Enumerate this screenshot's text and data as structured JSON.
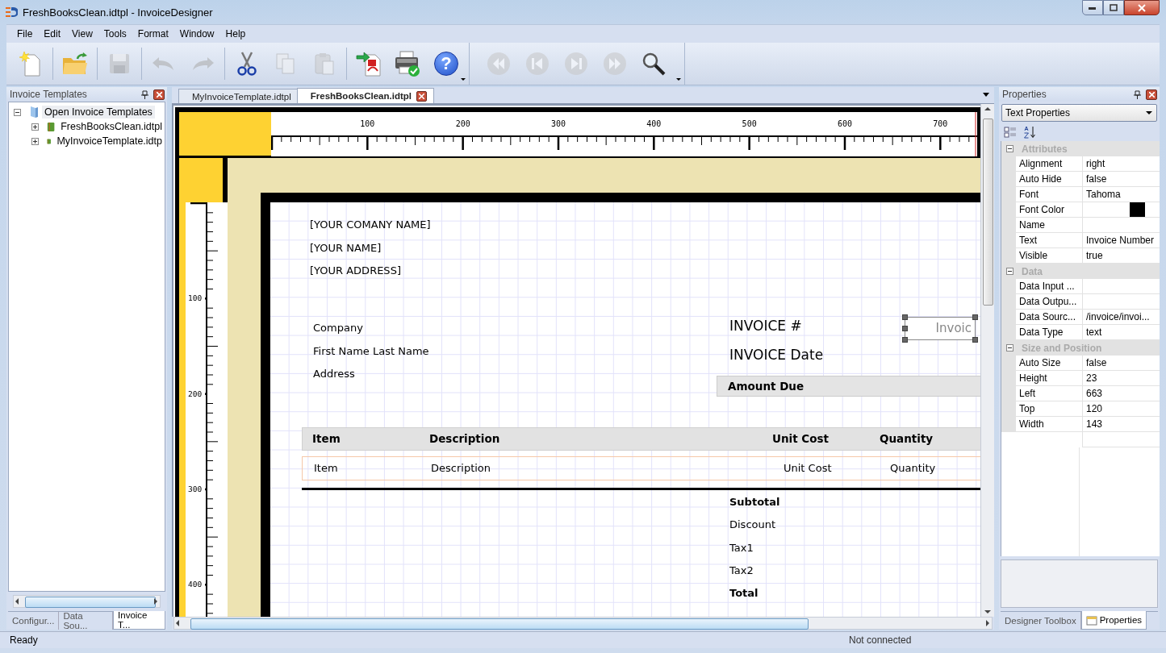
{
  "window": {
    "title": "FreshBooksClean.idtpl - InvoiceDesigner"
  },
  "menu": [
    {
      "label": "File"
    },
    {
      "label": "Edit"
    },
    {
      "label": "View"
    },
    {
      "label": "Tools"
    },
    {
      "label": "Format"
    },
    {
      "label": "Window"
    },
    {
      "label": "Help"
    }
  ],
  "toolbar": [
    {
      "kind": "new",
      "disabled": false
    },
    {
      "kind": "open",
      "disabled": false
    },
    {
      "kind": "save",
      "disabled": true
    },
    {
      "kind": "undo",
      "disabled": true
    },
    {
      "kind": "redo",
      "disabled": true
    },
    {
      "kind": "cut",
      "disabled": false
    },
    {
      "kind": "copy",
      "disabled": true
    },
    {
      "kind": "paste",
      "disabled": true
    },
    {
      "kind": "pdf",
      "disabled": false
    },
    {
      "kind": "print",
      "disabled": false
    },
    {
      "kind": "help",
      "disabled": false,
      "glyph": "?"
    }
  ],
  "navigation_toolbar": [
    {
      "kind": "first",
      "disabled": true
    },
    {
      "kind": "previous",
      "disabled": true
    },
    {
      "kind": "next",
      "disabled": true
    },
    {
      "kind": "last",
      "disabled": true
    },
    {
      "kind": "zoom",
      "disabled": false
    }
  ],
  "left_panel": {
    "title": "Invoice Templates",
    "tree": [
      {
        "label": "Open Invoice Templates",
        "selected": true,
        "expanded": true,
        "children": [
          {
            "label": "FreshBooksClean.idtpl",
            "selected": false,
            "expanded": false
          },
          {
            "label": "MyInvoiceTemplate.idtp",
            "selected": false,
            "expanded": false
          }
        ]
      }
    ],
    "tabs": [
      {
        "label": "Configur...",
        "selected": false
      },
      {
        "label": "Data Sou...",
        "selected": false
      },
      {
        "label": "Invoice T...",
        "selected": true
      }
    ]
  },
  "document_tabs": [
    {
      "label": "MyInvoiceTemplate.idtpl",
      "selected": false
    },
    {
      "label": "FreshBooksClean.idtpl",
      "selected": true
    }
  ],
  "canvas": {
    "h_ruler_labels": [
      "100",
      "200",
      "300",
      "400",
      "500",
      "600",
      "700"
    ],
    "v_ruler_labels": [
      "100",
      "200",
      "300",
      "400"
    ],
    "company_lines": [
      "[YOUR COMANY NAME]",
      "[YOUR NAME]",
      "[YOUR ADDRESS]"
    ],
    "customer_lines": [
      "Company",
      "First Name Last Name",
      "Address"
    ],
    "invoice_labels": [
      "INVOICE #",
      "INVOICE Date"
    ],
    "selected_field": "Invoic",
    "amount_due": "Amount Due",
    "table_header": [
      "Item",
      "Description",
      "Unit Cost",
      "Quantity"
    ],
    "table_row": [
      "Item",
      "Description",
      "Unit Cost",
      "Quantity"
    ],
    "totals": [
      {
        "label": "Subtotal",
        "bold": true
      },
      {
        "label": "Discount",
        "bold": false
      },
      {
        "label": "Tax1",
        "bold": false
      },
      {
        "label": "Tax2",
        "bold": false
      },
      {
        "label": "Total",
        "bold": true
      }
    ]
  },
  "properties": {
    "title": "Properties",
    "selector": "Text Properties",
    "categories": [
      {
        "name": "Attributes",
        "expanded": true,
        "rows": [
          {
            "name": "Alignment",
            "kind": "text",
            "value": "right"
          },
          {
            "name": "Auto Hide",
            "kind": "text",
            "value": "false"
          },
          {
            "name": "Font",
            "kind": "text",
            "value": "Tahoma"
          },
          {
            "name": "Font Color",
            "kind": "color",
            "color": "#000000"
          },
          {
            "name": "Name",
            "kind": "text"
          },
          {
            "name": "Text",
            "kind": "text",
            "value": "Invoice Number"
          },
          {
            "name": "Visible",
            "kind": "text",
            "value": "true"
          }
        ]
      },
      {
        "name": "Data",
        "expanded": true,
        "rows": [
          {
            "name": "Data Input ...",
            "kind": "text"
          },
          {
            "name": "Data Outpu...",
            "kind": "text"
          },
          {
            "name": "Data Sourc...",
            "kind": "text",
            "value": "/invoice/invoi..."
          },
          {
            "name": "Data Type",
            "kind": "text",
            "value": "text"
          }
        ]
      },
      {
        "name": "Size and Position",
        "expanded": true,
        "rows": [
          {
            "name": "Auto Size",
            "kind": "text",
            "value": "false"
          },
          {
            "name": "Height",
            "kind": "text",
            "value": "23"
          },
          {
            "name": "Left",
            "kind": "text",
            "value": "663"
          },
          {
            "name": "Top",
            "kind": "text",
            "value": "120"
          },
          {
            "name": "Width",
            "kind": "text",
            "value": "143"
          }
        ]
      }
    ],
    "tabs": [
      {
        "label": "Designer Toolbox",
        "selected": false
      },
      {
        "label": "Properties",
        "selected": true
      }
    ]
  },
  "status_bar": {
    "left": "Ready",
    "right": "Not connected"
  }
}
